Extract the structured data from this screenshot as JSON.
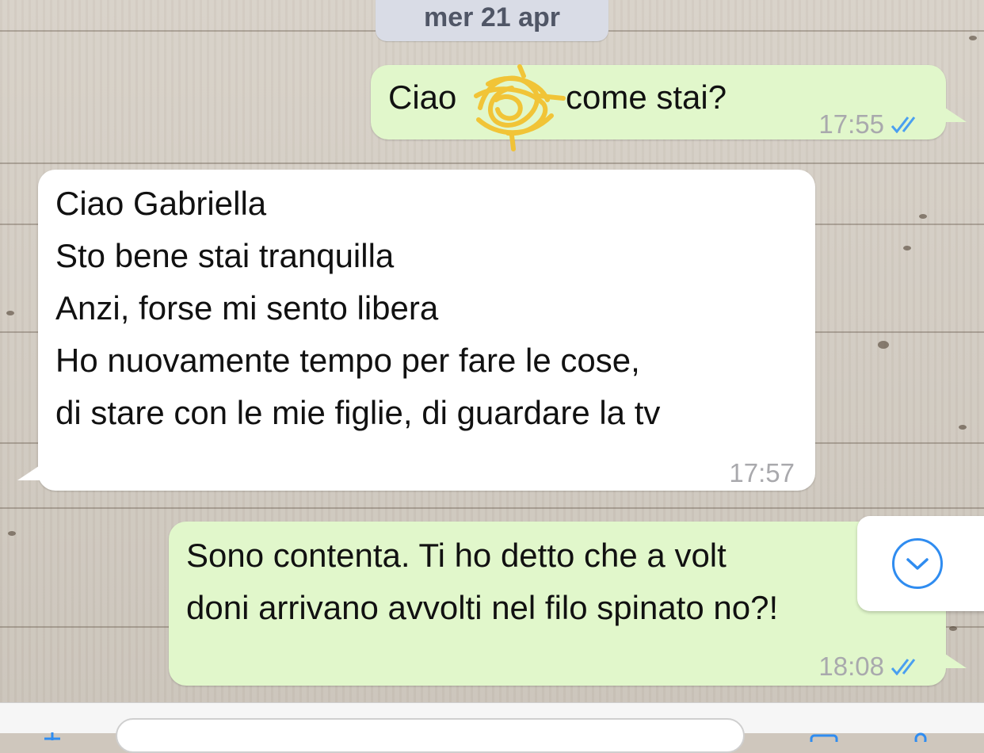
{
  "chat": {
    "date_separator": "mer 21 apr",
    "messages": [
      {
        "direction": "outgoing",
        "lines": [
          "Ciao",
          "come stai?"
        ],
        "time": "17:55",
        "status": "read"
      },
      {
        "direction": "incoming",
        "lines": [
          "Ciao Gabriella",
          "Sto bene stai tranquilla",
          "Anzi, forse mi sento libera",
          "Ho nuovamente tempo per fare le cose,",
          "di stare con le mie figlie, di guardare la tv"
        ],
        "time": "17:57"
      },
      {
        "direction": "outgoing",
        "lines": [
          "Sono contenta. Ti ho detto che a volt",
          "doni arrivano avvolti nel filo spinato no?!"
        ],
        "time": "18:08",
        "status": "read"
      }
    ]
  },
  "icons": {
    "read_receipt": "double-check-icon",
    "scroll_down": "chevron-down-icon",
    "redaction": "scribble-redaction"
  },
  "colors": {
    "outgoing_bubble": "#e1f7cb",
    "incoming_bubble": "#ffffff",
    "read_tick": "#4a9ff0",
    "accent": "#2f8cf0",
    "date_pill": "#d9dce6"
  }
}
